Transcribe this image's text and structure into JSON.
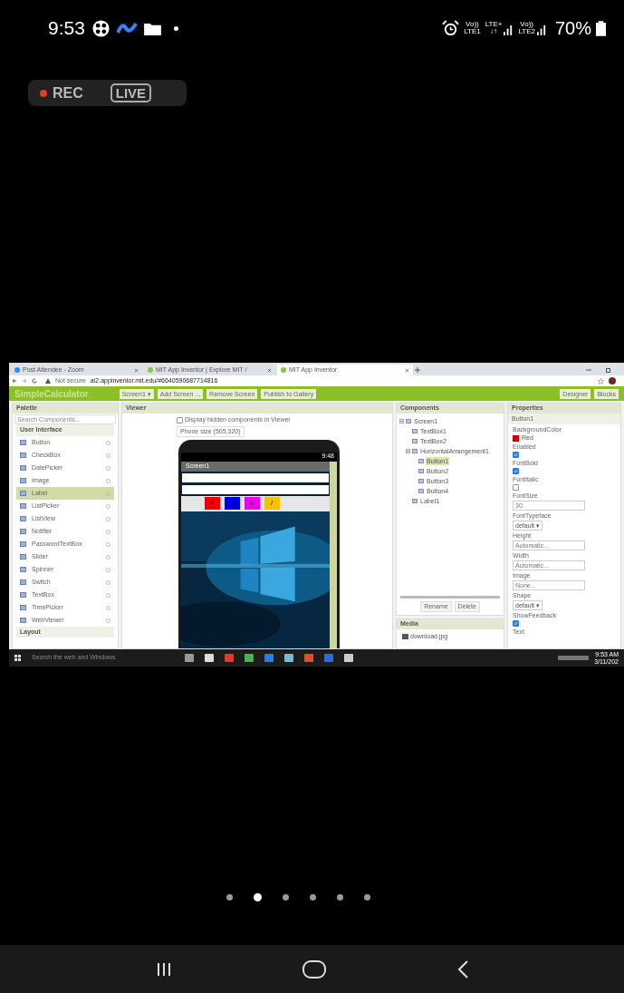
{
  "status_bar": {
    "time": "9:53",
    "signals": [
      {
        "top": "Vo))",
        "bottom": "LTE1"
      },
      {
        "top": "LTE+",
        "bottom": "↓↑"
      },
      {
        "top": "Vo))",
        "bottom": "LTE2"
      }
    ],
    "battery": "70%"
  },
  "recording": {
    "rec": "REC",
    "live": "LIVE"
  },
  "shared_screen": {
    "browser_tabs": [
      {
        "title": "Post Attendee - Zoom",
        "selected": false
      },
      {
        "title": "MIT App Inventor | Explore MIT /",
        "selected": false
      },
      {
        "title": "MIT App Inventor",
        "selected": true
      }
    ],
    "address": {
      "security": "Not secure",
      "url": "ai2.appinventor.mit.edu/#6640590687714816"
    },
    "app_bar": {
      "project": "SimpleCalculator",
      "buttons": [
        "Screen1 ▾",
        "Add Screen ...",
        "Remove Screen",
        "Publish to Gallery"
      ],
      "view_buttons": [
        "Designer",
        "Blocks"
      ]
    },
    "palette": {
      "title": "Palette",
      "search_placeholder": "Search Components...",
      "section": "User Interface",
      "items": [
        {
          "label": "Button",
          "selected": false
        },
        {
          "label": "CheckBox",
          "selected": false
        },
        {
          "label": "DatePicker",
          "selected": false
        },
        {
          "label": "Image",
          "selected": false
        },
        {
          "label": "Label",
          "selected": true
        },
        {
          "label": "ListPicker",
          "selected": false
        },
        {
          "label": "ListView",
          "selected": false
        },
        {
          "label": "Notifier",
          "selected": false
        },
        {
          "label": "PasswordTextBox",
          "selected": false
        },
        {
          "label": "Slider",
          "selected": false
        },
        {
          "label": "Spinner",
          "selected": false
        },
        {
          "label": "Switch",
          "selected": false
        },
        {
          "label": "TextBox",
          "selected": false
        },
        {
          "label": "TimePicker",
          "selected": false
        },
        {
          "label": "WebViewer",
          "selected": false
        }
      ],
      "next_section": "Layout"
    },
    "viewer": {
      "title": "Viewer",
      "hidden_checkbox": {
        "label": "Display hidden components in Viewer",
        "checked": false
      },
      "size_dropdown": "Phone size (505,320)",
      "phone": {
        "time": "9:48",
        "screen_title": "Screen1",
        "buttons": [
          {
            "label": "+",
            "color": "#ee0000"
          },
          {
            "label": "-",
            "color": "#0000dd"
          },
          {
            "label": "x",
            "color": "#ee00ee"
          },
          {
            "label": "/",
            "color": "#f5c000"
          }
        ]
      }
    },
    "components": {
      "title": "Components",
      "tree": [
        {
          "label": "Screen1",
          "expanded": true,
          "selected": false,
          "children": [
            {
              "label": "TextBox1",
              "selected": false
            },
            {
              "label": "TextBox2",
              "selected": false
            },
            {
              "label": "HorizontalArrangement1",
              "expanded": true,
              "selected": false,
              "children": [
                {
                  "label": "Button1",
                  "selected": true
                },
                {
                  "label": "Button2",
                  "selected": false
                },
                {
                  "label": "Button3",
                  "selected": false
                },
                {
                  "label": "Button4",
                  "selected": false
                }
              ]
            },
            {
              "label": "Label1",
              "selected": false
            }
          ]
        }
      ],
      "buttons": [
        "Rename",
        "Delete"
      ],
      "media_title": "Media",
      "media_files": [
        "download.jpg"
      ]
    },
    "properties": {
      "title": "Properties",
      "component": "Button1",
      "items": [
        {
          "kind": "color",
          "label": "BackgroundColor",
          "value": "Red",
          "color": "#cc0000"
        },
        {
          "kind": "checkbox",
          "label": "Enabled",
          "checked": true
        },
        {
          "kind": "checkbox",
          "label": "FontBold",
          "checked": true
        },
        {
          "kind": "checkbox",
          "label": "FontItalic",
          "checked": false
        },
        {
          "kind": "field",
          "label": "FontSize",
          "value": "30"
        },
        {
          "kind": "dropdown",
          "label": "FontTypeface",
          "value": "default ▾"
        },
        {
          "kind": "field",
          "label": "Height",
          "value": "Automatic..."
        },
        {
          "kind": "field",
          "label": "Width",
          "value": "Automatic..."
        },
        {
          "kind": "field",
          "label": "Image",
          "value": "None..."
        },
        {
          "kind": "dropdown",
          "label": "Shape",
          "value": "default ▾"
        },
        {
          "kind": "checkbox",
          "label": "ShowFeedback",
          "checked": true
        },
        {
          "kind": "heading",
          "label": "Text"
        }
      ]
    },
    "taskbar": {
      "search_placeholder": "Search the web and Windows",
      "clock": "9:53 AM",
      "date": "3/11/202"
    }
  },
  "pager": [
    {
      "selected": false
    },
    {
      "selected": true
    },
    {
      "selected": false
    },
    {
      "selected": false
    },
    {
      "selected": false
    },
    {
      "selected": false
    }
  ]
}
